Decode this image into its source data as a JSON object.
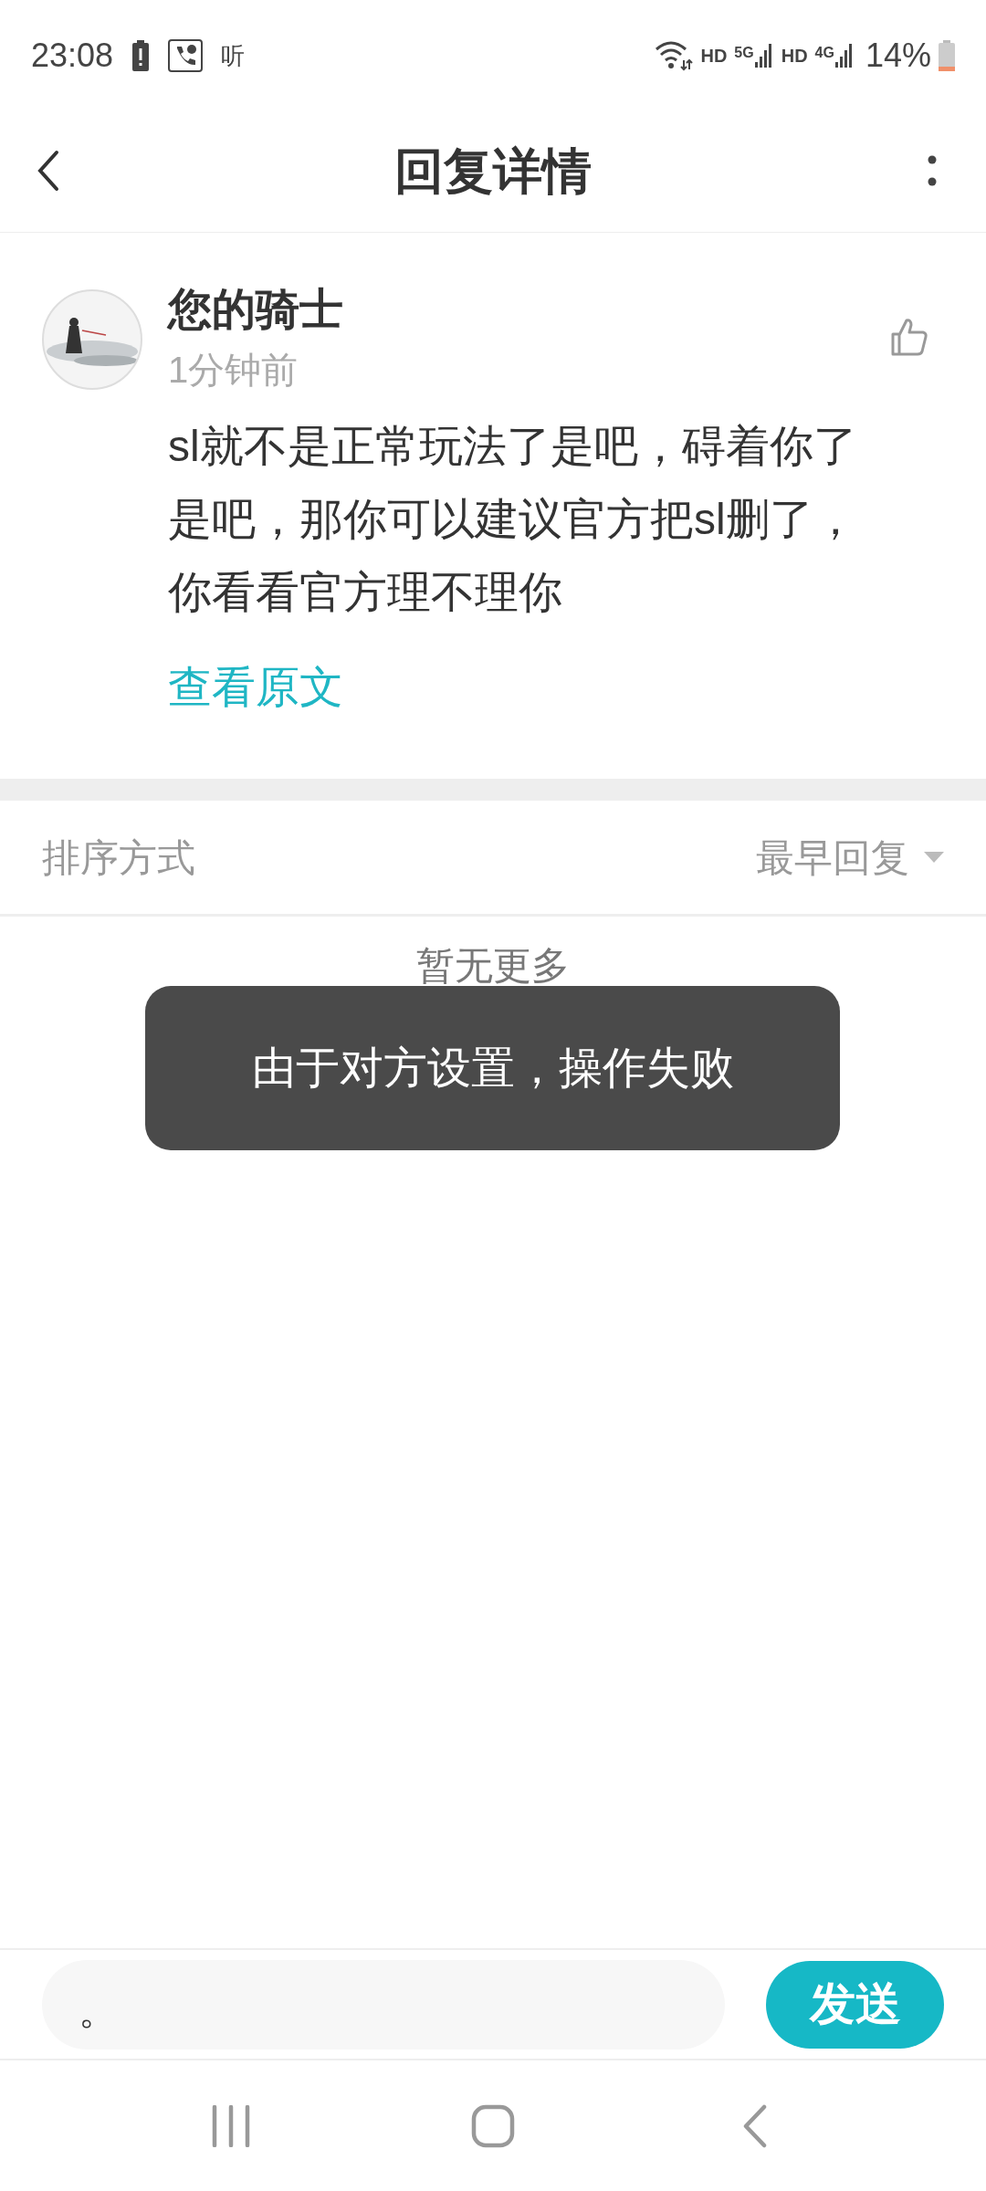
{
  "status_bar": {
    "time": "23:08",
    "listen": "听",
    "network": [
      {
        "hd": "HD",
        "gen": "5G"
      },
      {
        "hd": "HD",
        "gen": "4G"
      }
    ],
    "battery": "14%"
  },
  "header": {
    "title": "回复详情"
  },
  "comment": {
    "author": "您的骑士",
    "time": "1分钟前",
    "text": "sl就不是正常玩法了是吧，碍着你了是吧，那你可以建议官方把sl删了，你看看官方理不理你",
    "link": "查看原文"
  },
  "sort": {
    "label": "排序方式",
    "value": "最早回复"
  },
  "empty": "暂无更多",
  "toast": "由于对方设置，操作失败",
  "reply": {
    "value": "。",
    "send": "发送"
  }
}
